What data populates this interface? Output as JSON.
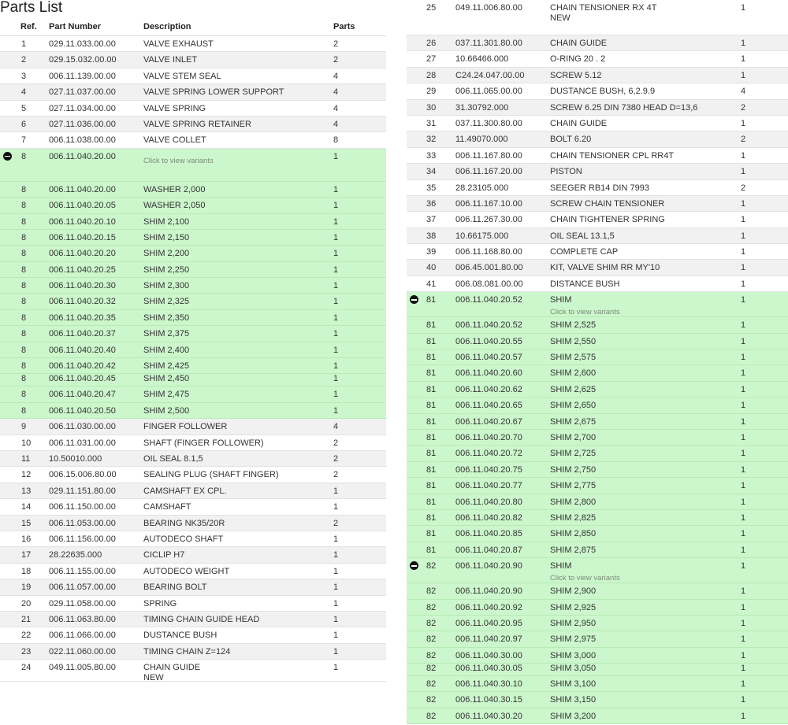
{
  "title": "Parts List",
  "headers": {
    "ref": "Ref.",
    "part_number": "Part Number",
    "description": "Description",
    "parts": "Parts"
  },
  "variant_hint": "Click to view variants",
  "left_rows": [
    {
      "ref": "1",
      "pn": "029.11.033.00.00",
      "desc": "VALVE EXHAUST",
      "qty": "2"
    },
    {
      "ref": "2",
      "pn": "029.15.032.00.00",
      "desc": "VALVE INLET",
      "qty": "2"
    },
    {
      "ref": "3",
      "pn": "006.11.139.00.00",
      "desc": "VALVE STEM SEAL",
      "qty": "4"
    },
    {
      "ref": "4",
      "pn": "027.11.037.00.00",
      "desc": "VALVE SPRING LOWER SUPPORT",
      "qty": "4"
    },
    {
      "ref": "5",
      "pn": "027.11.034.00.00",
      "desc": "VALVE SPRING",
      "qty": "4"
    },
    {
      "ref": "6",
      "pn": "027.11.036.00.00",
      "desc": "VALVE SPRING RETAINER",
      "qty": "4"
    },
    {
      "ref": "7",
      "pn": "006.11.038.00.00",
      "desc": "VALVE COLLET",
      "qty": "8"
    },
    {
      "ref": "8",
      "pn": "006.11.040.20.00",
      "desc": "",
      "qty": "1",
      "group": true,
      "green": true
    },
    {
      "ref": "8",
      "pn": "006.11.040.20.00",
      "desc": "WASHER 2,000",
      "qty": "1",
      "green": true
    },
    {
      "ref": "8",
      "pn": "006.11.040.20.05",
      "desc": "WASHER 2,050",
      "qty": "1",
      "green": true
    },
    {
      "ref": "8",
      "pn": "006.11.040.20.10",
      "desc": "SHIM 2,100",
      "qty": "1",
      "green": true
    },
    {
      "ref": "8",
      "pn": "006.11.040.20.15",
      "desc": "SHIM 2,150",
      "qty": "1",
      "green": true
    },
    {
      "ref": "8",
      "pn": "006.11.040.20.20",
      "desc": "SHIM 2,200",
      "qty": "1",
      "green": true
    },
    {
      "ref": "8",
      "pn": "006.11.040.20.25",
      "desc": "SHIM 2,250",
      "qty": "1",
      "green": true
    },
    {
      "ref": "8",
      "pn": "006.11.040.20.30",
      "desc": "SHIM 2,300",
      "qty": "1",
      "green": true
    },
    {
      "ref": "8",
      "pn": "006.11.040.20.32",
      "desc": "SHIM 2,325",
      "qty": "1",
      "green": true
    },
    {
      "ref": "8",
      "pn": "006.11.040.20.35",
      "desc": "SHIM 2,350",
      "qty": "1",
      "green": true
    },
    {
      "ref": "8",
      "pn": "006.11.040.20.37",
      "desc": "SHIM 2,375",
      "qty": "1",
      "green": true
    },
    {
      "ref": "8",
      "pn": "006.11.040.20.40",
      "desc": "SHIM 2,400",
      "qty": "1",
      "green": true
    },
    {
      "ref": "8",
      "pn": "006.11.040.20.42",
      "desc": "SHIM 2,425",
      "qty": "1",
      "green": true
    },
    {
      "ref": "8",
      "pn": "006.11.040.20.45",
      "desc": "SHIM 2,450",
      "qty": "1",
      "green": true,
      "short": true
    },
    {
      "ref": "8",
      "pn": "006.11.040.20.47",
      "desc": "SHIM 2,475",
      "qty": "1",
      "green": true
    },
    {
      "ref": "8",
      "pn": "006.11.040.20.50",
      "desc": "SHIM 2,500",
      "qty": "1",
      "green": true
    },
    {
      "ref": "9",
      "pn": "006.11.030.00.00",
      "desc": "FINGER FOLLOWER",
      "qty": "4"
    },
    {
      "ref": "10",
      "pn": "006.11.031.00.00",
      "desc": "SHAFT (FINGER FOLLOWER)",
      "qty": "2"
    },
    {
      "ref": "11",
      "pn": "10.50010.000",
      "desc": "OIL SEAL 8.1,5",
      "qty": "2"
    },
    {
      "ref": "12",
      "pn": "006.15.006.80.00",
      "desc": "SEALING PLUG (SHAFT FINGER)",
      "qty": "2"
    },
    {
      "ref": "13",
      "pn": "029.11.151.80.00",
      "desc": "CAMSHAFT EX CPL.",
      "qty": "1"
    },
    {
      "ref": "14",
      "pn": "006.11.150.00.00",
      "desc": "CAMSHAFT",
      "qty": "1"
    },
    {
      "ref": "15",
      "pn": "006.11.053.00.00",
      "desc": "BEARING NK35/20R",
      "qty": "2"
    },
    {
      "ref": "16",
      "pn": "006.11.156.00.00",
      "desc": "AUTODECO SHAFT",
      "qty": "1"
    },
    {
      "ref": "17",
      "pn": "28.22635.000",
      "desc": "CICLIP H7",
      "qty": "1"
    },
    {
      "ref": "18",
      "pn": "006.11.155.00.00",
      "desc": "AUTODECO WEIGHT",
      "qty": "1"
    },
    {
      "ref": "19",
      "pn": "006.11.057.00.00",
      "desc": "BEARING BOLT",
      "qty": "1"
    },
    {
      "ref": "20",
      "pn": "029.11.058.00.00",
      "desc": "SPRING",
      "qty": "1"
    },
    {
      "ref": "21",
      "pn": "006.11.063.80.00",
      "desc": "TIMING CHAIN GUIDE HEAD",
      "qty": "1"
    },
    {
      "ref": "22",
      "pn": "006.11.066.00.00",
      "desc": "DUSTANCE BUSH",
      "qty": "1"
    },
    {
      "ref": "23",
      "pn": "022.11.060.00.00",
      "desc": "TIMING CHAIN Z=124",
      "qty": "1"
    },
    {
      "ref": "24",
      "pn": "049.11.005.80.00",
      "desc": "CHAIN GUIDE",
      "desc2": "NEW",
      "qty": "1"
    }
  ],
  "right_rows": [
    {
      "ref": "25",
      "pn": "049.11.006.80.00",
      "desc": "CHAIN TENSIONER RX 4T",
      "desc2": "NEW",
      "qty": "1"
    },
    {
      "ref": "26",
      "pn": "037.11.301.80.00",
      "desc": "CHAIN GUIDE",
      "qty": "1"
    },
    {
      "ref": "27",
      "pn": "10.66466.000",
      "desc": "O-RING 20 . 2",
      "qty": "1"
    },
    {
      "ref": "28",
      "pn": "C24.24.047.00.00",
      "desc": "SCREW 5.12",
      "qty": "1"
    },
    {
      "ref": "29",
      "pn": "006.11.065.00.00",
      "desc": "DUSTANCE BUSH, 6,2.9.9",
      "qty": "4"
    },
    {
      "ref": "30",
      "pn": "31.30792.000",
      "desc": "SCREW 6.25 DIN 7380 HEAD D=13,6",
      "qty": "2"
    },
    {
      "ref": "31",
      "pn": "037.11.300.80.00",
      "desc": "CHAIN GUIDE",
      "qty": "1"
    },
    {
      "ref": "32",
      "pn": "11.49070.000",
      "desc": "BOLT 6.20",
      "qty": "2"
    },
    {
      "ref": "33",
      "pn": "006.11.167.80.00",
      "desc": "CHAIN TENSIONER CPL RR4T",
      "qty": "1"
    },
    {
      "ref": "34",
      "pn": "006.11.167.20.00",
      "desc": "PISTON",
      "qty": "1"
    },
    {
      "ref": "35",
      "pn": "28.23105.000",
      "desc": "SEEGER RB14 DIN 7993",
      "qty": "2"
    },
    {
      "ref": "36",
      "pn": "006.11.167.10.00",
      "desc": "SCREW CHAIN TENSIONER",
      "qty": "1"
    },
    {
      "ref": "37",
      "pn": "006.11.267.30.00",
      "desc": "CHAIN TIGHTENER SPRING",
      "qty": "1"
    },
    {
      "ref": "38",
      "pn": "10.66175.000",
      "desc": "OIL SEAL 13.1,5",
      "qty": "1"
    },
    {
      "ref": "39",
      "pn": "006.11.168.80.00",
      "desc": "COMPLETE CAP",
      "qty": "1"
    },
    {
      "ref": "40",
      "pn": "006.45.001.80.00",
      "desc": "KIT, VALVE SHIM RR MY'10",
      "qty": "1"
    },
    {
      "ref": "41",
      "pn": "006.08.081.00.00",
      "desc": "DISTANCE BUSH",
      "qty": "1"
    },
    {
      "ref": "81",
      "pn": "006.11.040.20.52",
      "desc": "SHIM",
      "qty": "1",
      "group": true,
      "green": true
    },
    {
      "ref": "81",
      "pn": "006.11.040.20.52",
      "desc": "SHIM 2,525",
      "qty": "1",
      "green": true
    },
    {
      "ref": "81",
      "pn": "006.11.040.20.55",
      "desc": "SHIM 2,550",
      "qty": "1",
      "green": true
    },
    {
      "ref": "81",
      "pn": "006.11.040.20.57",
      "desc": "SHIM 2,575",
      "qty": "1",
      "green": true
    },
    {
      "ref": "81",
      "pn": "006.11.040.20.60",
      "desc": "SHIM 2,600",
      "qty": "1",
      "green": true
    },
    {
      "ref": "81",
      "pn": "006.11.040.20.62",
      "desc": "SHIM 2,625",
      "qty": "1",
      "green": true
    },
    {
      "ref": "81",
      "pn": "006.11.040.20.65",
      "desc": "SHIM 2,650",
      "qty": "1",
      "green": true
    },
    {
      "ref": "81",
      "pn": "006.11.040.20.67",
      "desc": "SHIM 2,675",
      "qty": "1",
      "green": true
    },
    {
      "ref": "81",
      "pn": "006.11.040.20.70",
      "desc": "SHIM 2,700",
      "qty": "1",
      "green": true
    },
    {
      "ref": "81",
      "pn": "006.11.040.20.72",
      "desc": "SHIM 2,725",
      "qty": "1",
      "green": true
    },
    {
      "ref": "81",
      "pn": "006.11.040.20.75",
      "desc": "SHIM 2,750",
      "qty": "1",
      "green": true
    },
    {
      "ref": "81",
      "pn": "006.11.040.20.77",
      "desc": "SHIM 2,775",
      "qty": "1",
      "green": true
    },
    {
      "ref": "81",
      "pn": "006.11.040.20.80",
      "desc": "SHIM 2,800",
      "qty": "1",
      "green": true
    },
    {
      "ref": "81",
      "pn": "006.11.040.20.82",
      "desc": "SHIM 2,825",
      "qty": "1",
      "green": true
    },
    {
      "ref": "81",
      "pn": "006.11.040.20.85",
      "desc": "SHIM 2,850",
      "qty": "1",
      "green": true
    },
    {
      "ref": "81",
      "pn": "006.11.040.20.87",
      "desc": "SHIM 2,875",
      "qty": "1",
      "green": true
    },
    {
      "ref": "82",
      "pn": "006.11.040.20.90",
      "desc": "SHIM",
      "qty": "1",
      "group": true,
      "green": true
    },
    {
      "ref": "82",
      "pn": "006.11.040.20.90",
      "desc": "SHIM 2,900",
      "qty": "1",
      "green": true
    },
    {
      "ref": "82",
      "pn": "006.11.040.20.92",
      "desc": "SHIM 2,925",
      "qty": "1",
      "green": true
    },
    {
      "ref": "82",
      "pn": "006.11.040.20.95",
      "desc": "SHIM 2,950",
      "qty": "1",
      "green": true
    },
    {
      "ref": "82",
      "pn": "006.11.040.20.97",
      "desc": "SHIM 2,975",
      "qty": "1",
      "green": true
    },
    {
      "ref": "82",
      "pn": "006.11.040.30.00",
      "desc": "SHIM 3,000",
      "qty": "1",
      "green": true
    },
    {
      "ref": "82",
      "pn": "006.11.040.30.05",
      "desc": "SHIM 3,050",
      "qty": "1",
      "green": true,
      "short": true
    },
    {
      "ref": "82",
      "pn": "006.11.040.30.10",
      "desc": "SHIM 3,100",
      "qty": "1",
      "green": true
    },
    {
      "ref": "82",
      "pn": "006.11.040.30.15",
      "desc": "SHIM 3,150",
      "qty": "1",
      "green": true
    },
    {
      "ref": "82",
      "pn": "006.11.040.30.20",
      "desc": "SHIM 3,200",
      "qty": "1",
      "green": true
    }
  ]
}
